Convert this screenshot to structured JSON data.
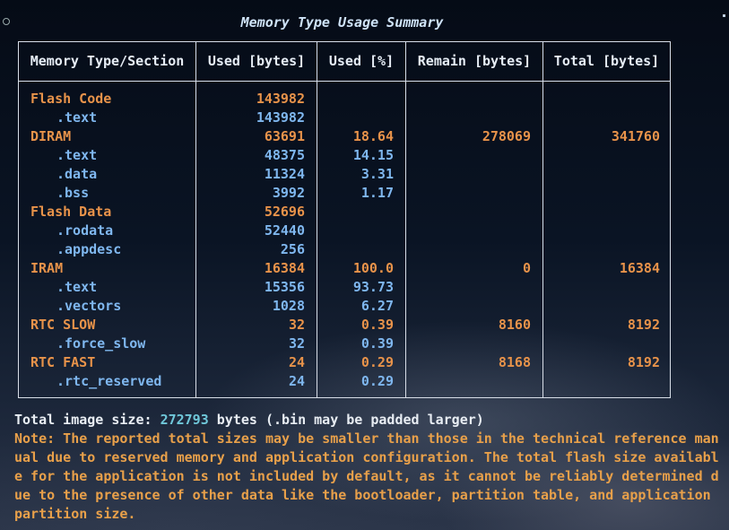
{
  "title": "Memory Type Usage Summary",
  "headers": [
    "Memory Type/Section",
    "Used [bytes]",
    "Used [%]",
    "Remain [bytes]",
    "Total [bytes]"
  ],
  "rows": [
    {
      "name": "Flash Code",
      "used": "143982",
      "pct": "",
      "remain": "",
      "total": ""
    },
    {
      "name": ".text",
      "used": "143982",
      "pct": "",
      "remain": "",
      "total": ""
    },
    {
      "name": "DIRAM",
      "used": "63691",
      "pct": "18.64",
      "remain": "278069",
      "total": "341760"
    },
    {
      "name": ".text",
      "used": "48375",
      "pct": "14.15",
      "remain": "",
      "total": ""
    },
    {
      "name": ".data",
      "used": "11324",
      "pct": "3.31",
      "remain": "",
      "total": ""
    },
    {
      "name": ".bss",
      "used": "3992",
      "pct": "1.17",
      "remain": "",
      "total": ""
    },
    {
      "name": "Flash Data",
      "used": "52696",
      "pct": "",
      "remain": "",
      "total": ""
    },
    {
      "name": ".rodata",
      "used": "52440",
      "pct": "",
      "remain": "",
      "total": ""
    },
    {
      "name": ".appdesc",
      "used": "256",
      "pct": "",
      "remain": "",
      "total": ""
    },
    {
      "name": "IRAM",
      "used": "16384",
      "pct": "100.0",
      "remain": "0",
      "total": "16384"
    },
    {
      "name": ".text",
      "used": "15356",
      "pct": "93.73",
      "remain": "",
      "total": ""
    },
    {
      "name": ".vectors",
      "used": "1028",
      "pct": "6.27",
      "remain": "",
      "total": ""
    },
    {
      "name": "RTC SLOW",
      "used": "32",
      "pct": "0.39",
      "remain": "8160",
      "total": "8192"
    },
    {
      "name": ".force_slow",
      "used": "32",
      "pct": "0.39",
      "remain": "",
      "total": ""
    },
    {
      "name": "RTC FAST",
      "used": "24",
      "pct": "0.29",
      "remain": "8168",
      "total": "8192"
    },
    {
      "name": ".rtc_reserved",
      "used": "24",
      "pct": "0.29",
      "remain": "",
      "total": ""
    }
  ],
  "footer": {
    "total_prefix": "Total image size: ",
    "total_value": "272793",
    "total_suffix": " bytes (.bin may be padded larger)",
    "note_lines": [
      "Note: The reported total sizes may be smaller than those in the technical reference man",
      "ual due to reserved memory and application configuration. The total flash size availabl",
      "e for the application is not included by default, as it cannot be reliably determined d",
      "ue to the presence of other data like the bootloader, partition table, and application",
      "partition size."
    ]
  },
  "colors": {
    "section": "#e8934a",
    "subsection": "#7fb7ef",
    "total_value": "#6fc7d9",
    "note": "#e8a04a"
  }
}
